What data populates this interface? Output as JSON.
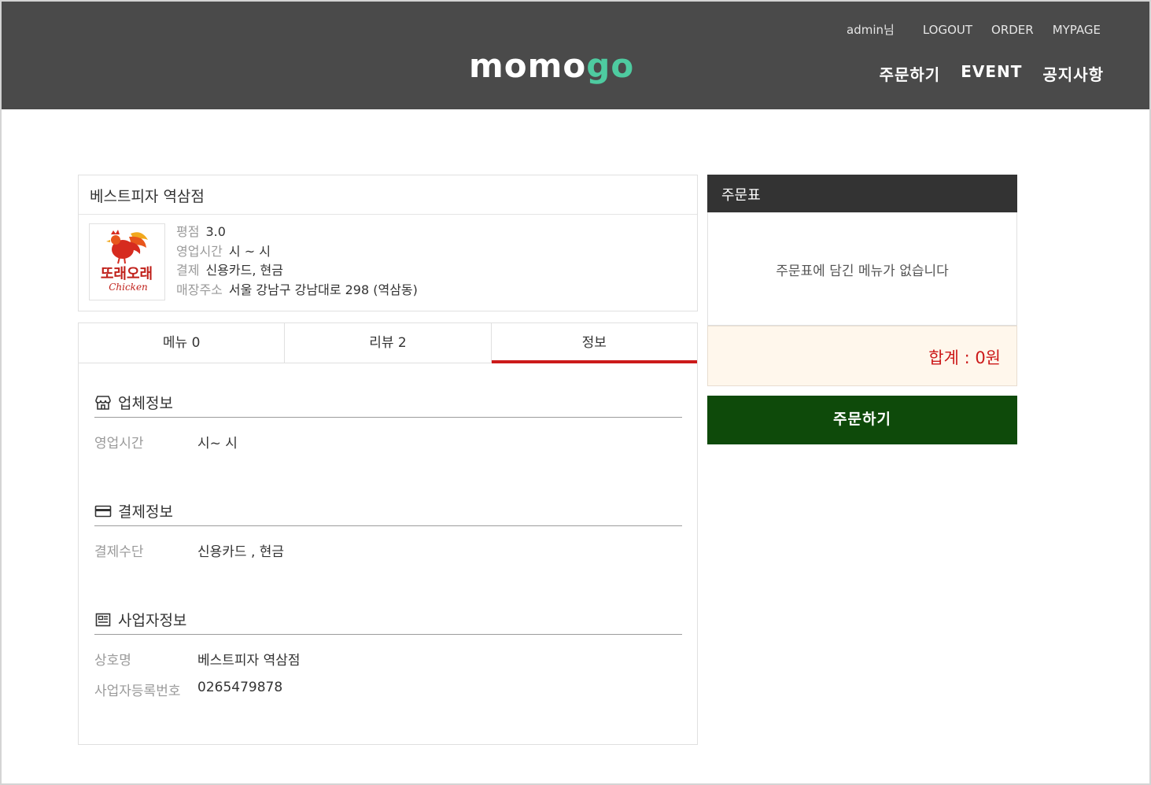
{
  "header": {
    "logo_part1": "momo",
    "logo_part2": "go",
    "user": "admin님",
    "top_links": [
      "LOGOUT",
      "ORDER",
      "MYPAGE"
    ],
    "main_nav": [
      "주문하기",
      "EVENT",
      "공지사항"
    ]
  },
  "store": {
    "name": "베스트피자 역삼점",
    "logo_text": "또래오래",
    "logo_sub": "Chicken",
    "info": [
      {
        "label": "평점",
        "value": "3.0"
      },
      {
        "label": "영업시간",
        "value": "시 ~ 시"
      },
      {
        "label": "결제",
        "value": "신용카드, 현금"
      },
      {
        "label": "매장주소",
        "value": "서울 강남구 강남대로 298 (역삼동)"
      }
    ]
  },
  "tabs": [
    "메뉴 0",
    "리뷰 2",
    "정보"
  ],
  "sections": {
    "business": {
      "title": "업체정보",
      "rows": [
        {
          "label": "영업시간",
          "value": "시~ 시"
        }
      ]
    },
    "payment": {
      "title": "결제정보",
      "rows": [
        {
          "label": "결제수단",
          "value": "신용카드 , 현금"
        }
      ]
    },
    "owner": {
      "title": "사업자정보",
      "rows": [
        {
          "label": "상호명",
          "value": "베스트피자 역삼점"
        },
        {
          "label": "사업자등록번호",
          "value": "0265479878"
        }
      ]
    }
  },
  "order": {
    "title": "주문표",
    "empty_message": "주문표에 담긴 메뉴가 없습니다",
    "total": "합계 : 0원",
    "button": "주문하기"
  },
  "colors": {
    "header_bg": "#4a4a4a",
    "logo_accent": "#4ecba0",
    "tab_active": "#cc1a1a",
    "order_button": "#0e4a0a",
    "total_bg": "#fff7ec"
  }
}
